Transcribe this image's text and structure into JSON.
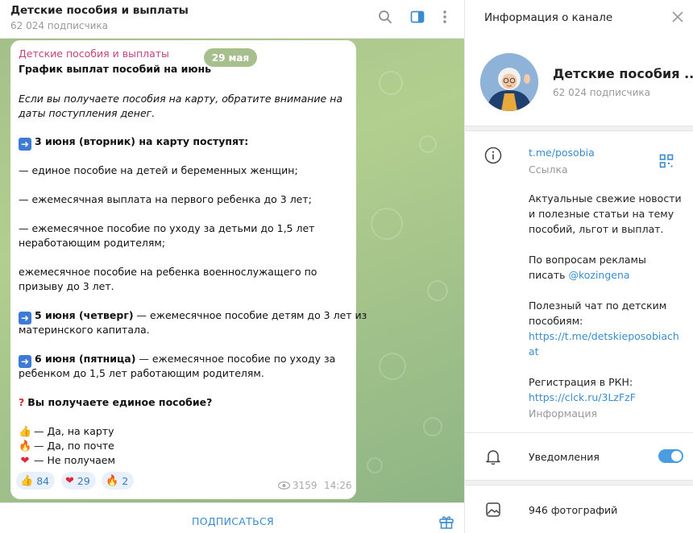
{
  "chat": {
    "title": "Детские пособия и выплаты",
    "subscribers": "62 024 подписчика",
    "footer_button": "ПОДПИСАТЬСЯ"
  },
  "message": {
    "author": "Детские пособия и выплаты",
    "date_pill": "29 мая",
    "title": "График выплат пособий на июнь",
    "intro_line1": "Если вы получаете пособия на карту, обратите внимание на",
    "intro_line2": "даты поступления денег.",
    "s1_heading": "3 июня (вторник) на карту поступят:",
    "s1_item1": "— единое пособие на детей и беременных женщин;",
    "s1_item2": "— ежемесячная выплата на первого ребенка до 3 лет;",
    "s1_item3_line1": "— ежемесячное пособие по уходу за детьми до 1,5 лет",
    "s1_item3_line2": "неработающим родителям;",
    "s1_item4_line1": "ежемесячное пособие на ребенка военнослужащего по",
    "s1_item4_line2": "призыву до 3 лет.",
    "s2_bold": "5 июня (четверг)",
    "s2_rest": " — ежемесячное пособие детям до 3 лет из",
    "s2_line2": "материнского капитала.",
    "s3_bold": "6 июня (пятница)",
    "s3_rest": " — ежемесячное пособие по уходу за",
    "s3_line2": "ребенком до 1,5 лет работающим родителям.",
    "question": "Вы получаете единое пособие?",
    "answer1": "— Да, на карту",
    "answer2": "— Да, по почте",
    "answer3": "— Не получаем",
    "reactions": [
      {
        "emoji": "👍",
        "count": "84"
      },
      {
        "emoji": "❤",
        "count": "29"
      },
      {
        "emoji": "🔥",
        "count": "2"
      }
    ],
    "views": "3159",
    "time": "14:26"
  },
  "info": {
    "panel_title": "Информация о канале",
    "channel_name": "Детские пособия ...",
    "subscribers": "62 024 подписчика",
    "link": "t.me/posobia",
    "link_label": "Ссылка",
    "desc_line1": "Актуальные свежие новости",
    "desc_line2": "и полезные статьи на тему",
    "desc_line3": "пособий, льгот и выплат.",
    "ads_line1": "По вопросам рекламы",
    "ads_line2_prefix": "писать ",
    "ads_contact": "@kozingena",
    "chat_line1": "Полезный чат по детским",
    "chat_line2": "пособиям:",
    "chat_url_line1": "https://t.me/detskieposobiach",
    "chat_url_line2": "at",
    "rkn_line": "Регистрация в РКН:",
    "rkn_url": "https://clck.ru/3LzFzF",
    "info_label": "Информация",
    "notifications_label": "Уведомления",
    "notifications_on": true,
    "photos_label": "946 фотографий"
  },
  "colors": {
    "accent": "#3a8ccf",
    "author": "#c3447b",
    "toggle": "#4a9de0",
    "chat_bg": "#a4c08a"
  },
  "icons": [
    "search-icon",
    "sidebar-toggle-icon",
    "more-vert-icon",
    "close-icon",
    "info-icon",
    "qr-code-icon",
    "bell-icon",
    "photo-icon",
    "gift-icon",
    "eye-icon"
  ]
}
